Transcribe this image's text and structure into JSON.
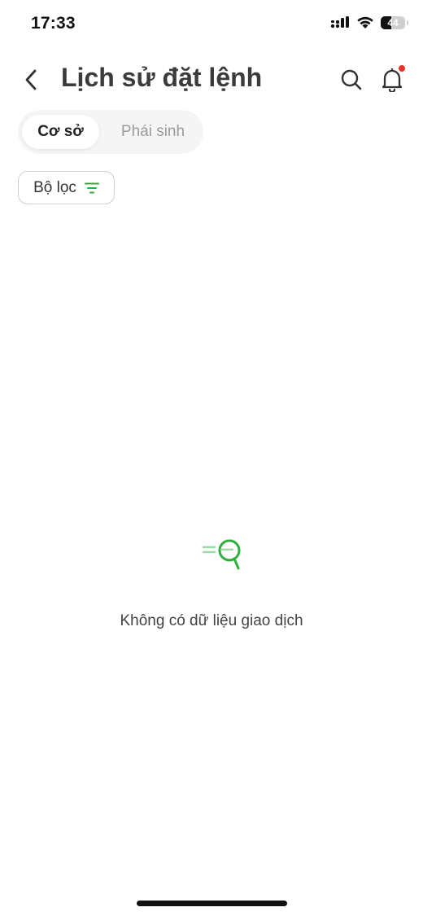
{
  "status_bar": {
    "time": "17:33",
    "battery_level": "44",
    "battery_fraction": 0.44
  },
  "header": {
    "title": "Lịch sử đặt lệnh",
    "back_icon": "chevron-left-icon",
    "search_icon": "search-icon",
    "notification_icon": "bell-icon",
    "notification_dot_color": "#e8352b"
  },
  "tabs": [
    {
      "label": "Cơ sở",
      "active": true
    },
    {
      "label": "Phái sinh",
      "active": false
    }
  ],
  "filter": {
    "label": "Bộ lọc",
    "icon": "filter-icon",
    "icon_color": "#2fae3f"
  },
  "empty_state": {
    "icon": "search-empty-icon",
    "icon_color": "#2fae3f",
    "message": "Không có dữ liệu giao dịch"
  }
}
